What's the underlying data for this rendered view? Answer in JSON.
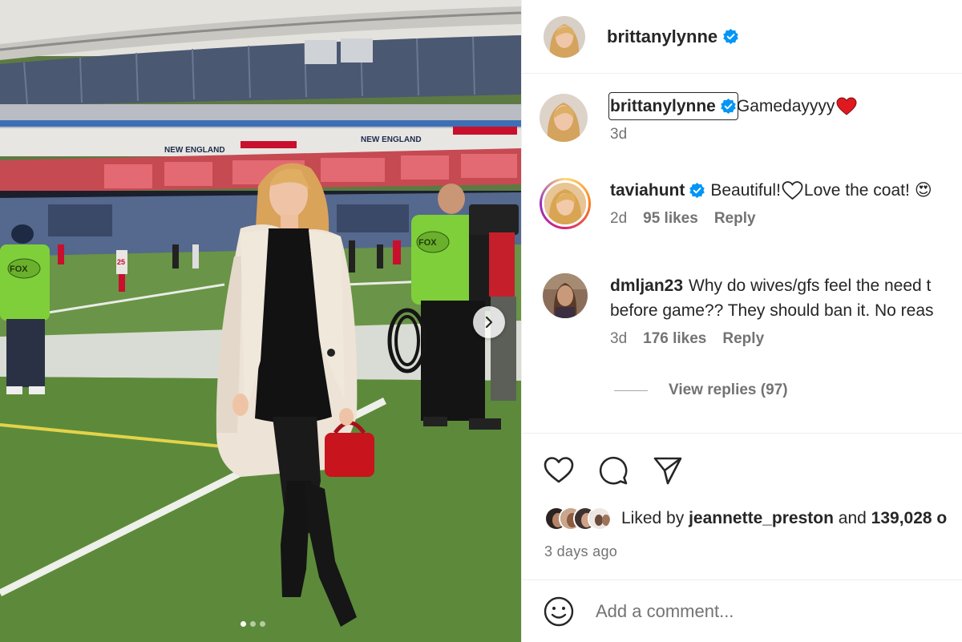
{
  "post": {
    "author": "brittanylynne",
    "caption": "Gamedayyyy",
    "caption_emoji": "❤️",
    "caption_time": "3d",
    "image_slides": 3,
    "active_slide": 1,
    "photo_text": {
      "fox_badge_left": "FOX",
      "fox_badge_right": "FOX",
      "stadium_sign_1": "NEW ENGLAND",
      "stadium_sign_2": "NEW ENGLAND",
      "player_number": "25"
    }
  },
  "comments": [
    {
      "username": "taviahunt",
      "verified": true,
      "text_1": "Beautiful!",
      "text_2": "Love the coat!",
      "emoji": "😍",
      "time": "2d",
      "likes": "95 likes",
      "reply": "Reply"
    },
    {
      "username": "dmljan23",
      "verified": false,
      "text_line1": "Why do wives/gfs feel the need t",
      "text_line2": "before game?? They should ban it. No reas",
      "time": "3d",
      "likes": "176 likes",
      "reply": "Reply",
      "view_replies": "View replies (97)"
    }
  ],
  "likes_summary": {
    "prefix": "Liked by ",
    "user": "jeannette_preston",
    "middle": " and ",
    "count": "139,028 o"
  },
  "timestamp": "3 days ago",
  "add_comment": {
    "placeholder": "Add a comment..."
  },
  "colors": {
    "verified": "#0095f6",
    "heart_red": "#ed4956",
    "text": "#262626",
    "muted": "#737373"
  }
}
